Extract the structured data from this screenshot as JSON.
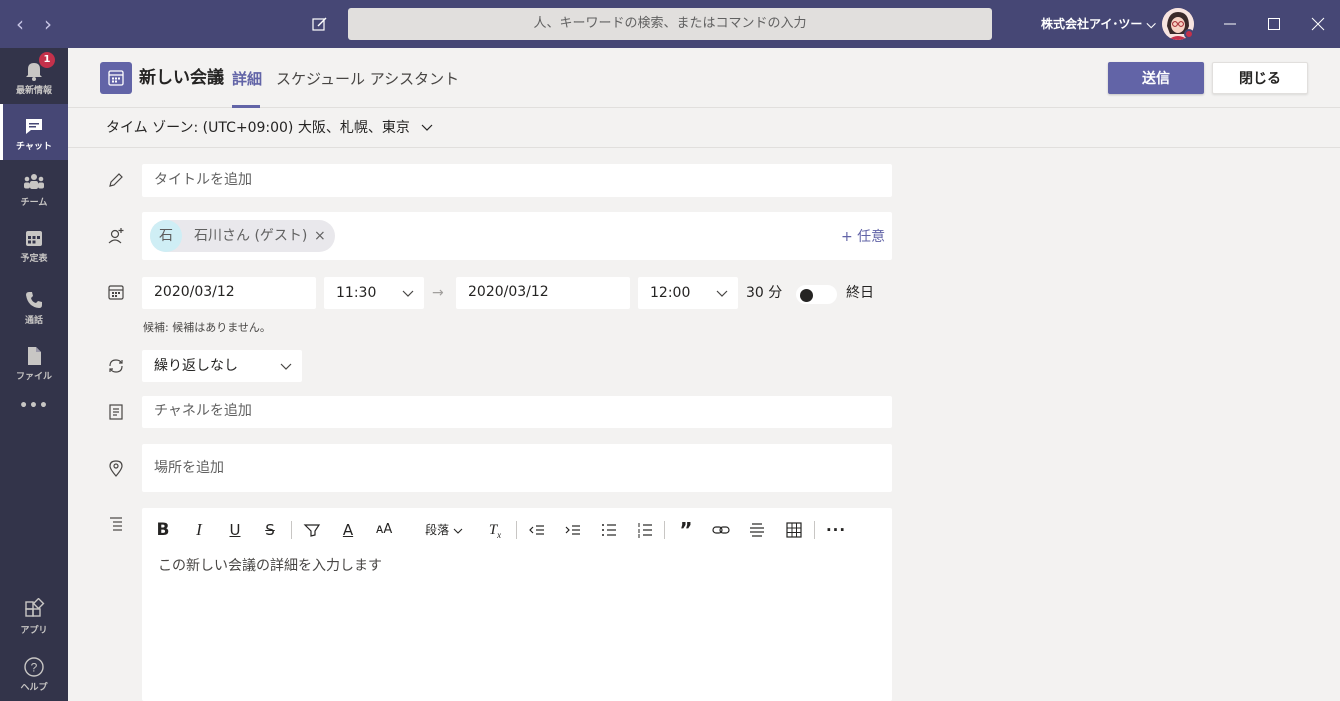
{
  "titlebar": {
    "search_placeholder": "人、キーワードの検索、またはコマンドの入力",
    "org_name": "株式会社アイ･ツー ⌵"
  },
  "rail": {
    "items": [
      {
        "label": "最新情報",
        "icon": "bell-icon",
        "badge": "1"
      },
      {
        "label": "チャット",
        "icon": "chat-icon"
      },
      {
        "label": "チーム",
        "icon": "teams-icon"
      },
      {
        "label": "予定表",
        "icon": "calendar-icon"
      },
      {
        "label": "通話",
        "icon": "phone-icon"
      },
      {
        "label": "ファイル",
        "icon": "file-icon"
      },
      {
        "label": "•••",
        "icon": "more-icon"
      },
      {
        "label": "アプリ",
        "icon": "apps-icon"
      },
      {
        "label": "ヘルプ",
        "icon": "help-icon"
      }
    ]
  },
  "header": {
    "title": "新しい会議",
    "tab_details": "詳細",
    "tab_scheduling": "スケジュール アシスタント",
    "send_label": "送信",
    "close_label": "閉じる"
  },
  "timezone": {
    "label": "タイム ゾーン: (UTC+09:00) 大阪、札幌、東京"
  },
  "form": {
    "title_placeholder": "タイトルを追加",
    "attendee_initial": "石",
    "attendee_name": "石川さん (ゲスト)",
    "attendee_remove": "×",
    "optional_label": "+ 任意",
    "start_date": "2020/03/12",
    "start_time": "11:30",
    "arrow": "→",
    "end_date": "2020/03/12",
    "end_time": "12:00",
    "duration": "30 分",
    "all_day_label": "終日",
    "all_day_on": false,
    "suggestion_hint": "候補: 候補はありません。",
    "repeat_value": "繰り返しなし",
    "channel_placeholder": "チャネルを追加",
    "location_placeholder": "場所を追加"
  },
  "editor": {
    "paragraph_label": "段落",
    "placeholder": "この新しい会議の詳細を入力します",
    "toolbar": [
      "bold-icon",
      "italic-icon",
      "underline-icon",
      "strikethrough-icon",
      "highlight-icon",
      "font-color-icon",
      "font-size-icon",
      "paragraph-dropdown",
      "clear-format-icon",
      "outdent-icon",
      "indent-icon",
      "bullet-list-icon",
      "numbered-list-icon",
      "quote-icon",
      "link-icon",
      "align-center-icon",
      "table-icon",
      "more-options-icon"
    ]
  },
  "colors": {
    "brand": "#6264a7",
    "titlebar": "#464775",
    "rail": "#33344a",
    "background": "#f3f2f1"
  }
}
